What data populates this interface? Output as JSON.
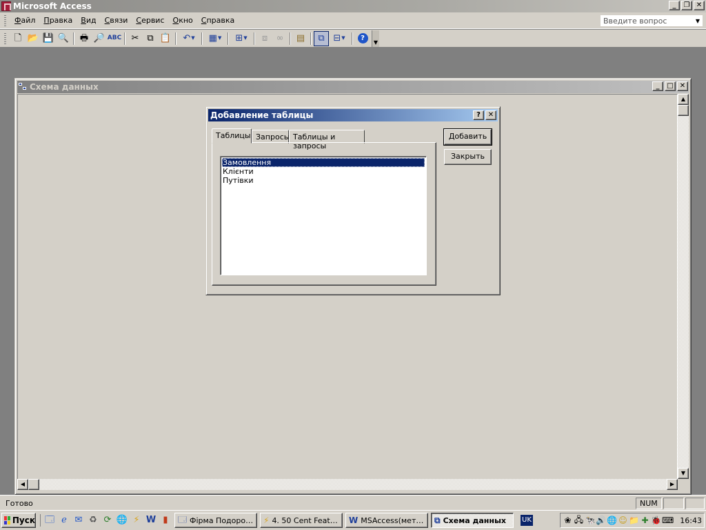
{
  "app": {
    "title": "Microsoft Access"
  },
  "menu": {
    "items": [
      "Файл",
      "Правка",
      "Вид",
      "Связи",
      "Сервис",
      "Окно",
      "Справка"
    ],
    "ask_placeholder": "Введите вопрос"
  },
  "toolbar": {
    "buttons": [
      "new-icon",
      "open-icon",
      "save-icon",
      "file-search-icon",
      "print-icon",
      "print-preview-icon",
      "spelling-icon",
      "cut-icon",
      "copy-icon",
      "paste-icon",
      "undo-icon",
      "clear-layout-icon",
      "show-table-icon",
      "show-direct-icon",
      "show-all-icon",
      "hide-table-icon",
      "direct-relationships-icon",
      "properties-icon",
      "new-object-icon",
      "help-icon"
    ]
  },
  "child_window": {
    "title": "Схема данных"
  },
  "dialog": {
    "title": "Добавление таблицы",
    "help_button": "?",
    "tabs": [
      "Таблицы",
      "Запросы",
      "Таблицы и запросы"
    ],
    "active_tab": "Таблицы",
    "list_items": [
      "Замовлення",
      "Клієнти",
      "Путівки"
    ],
    "selected_item": "Замовлення",
    "add_button": "Добавить",
    "close_button": "Закрыть"
  },
  "statusbar": {
    "status": "Готово",
    "num": "NUM"
  },
  "taskbar": {
    "start_label": "Пуск",
    "tasks": [
      {
        "label": "Фірма Подорож ...",
        "icon": "access-icon",
        "active": false
      },
      {
        "label": "4. 50 Cent Feat....",
        "icon": "winamp-icon",
        "active": false
      },
      {
        "label": "MSAccess(мето...",
        "icon": "word-icon",
        "active": false
      },
      {
        "label": "Схема данных",
        "icon": "relationships-icon",
        "active": true
      }
    ],
    "language": "UK",
    "clock": "16:43"
  },
  "colors": {
    "dialog_title_start": "#0a246a",
    "dialog_title_end": "#a6caf0",
    "selection": "#0a246a",
    "face": "#d4d0c8"
  }
}
